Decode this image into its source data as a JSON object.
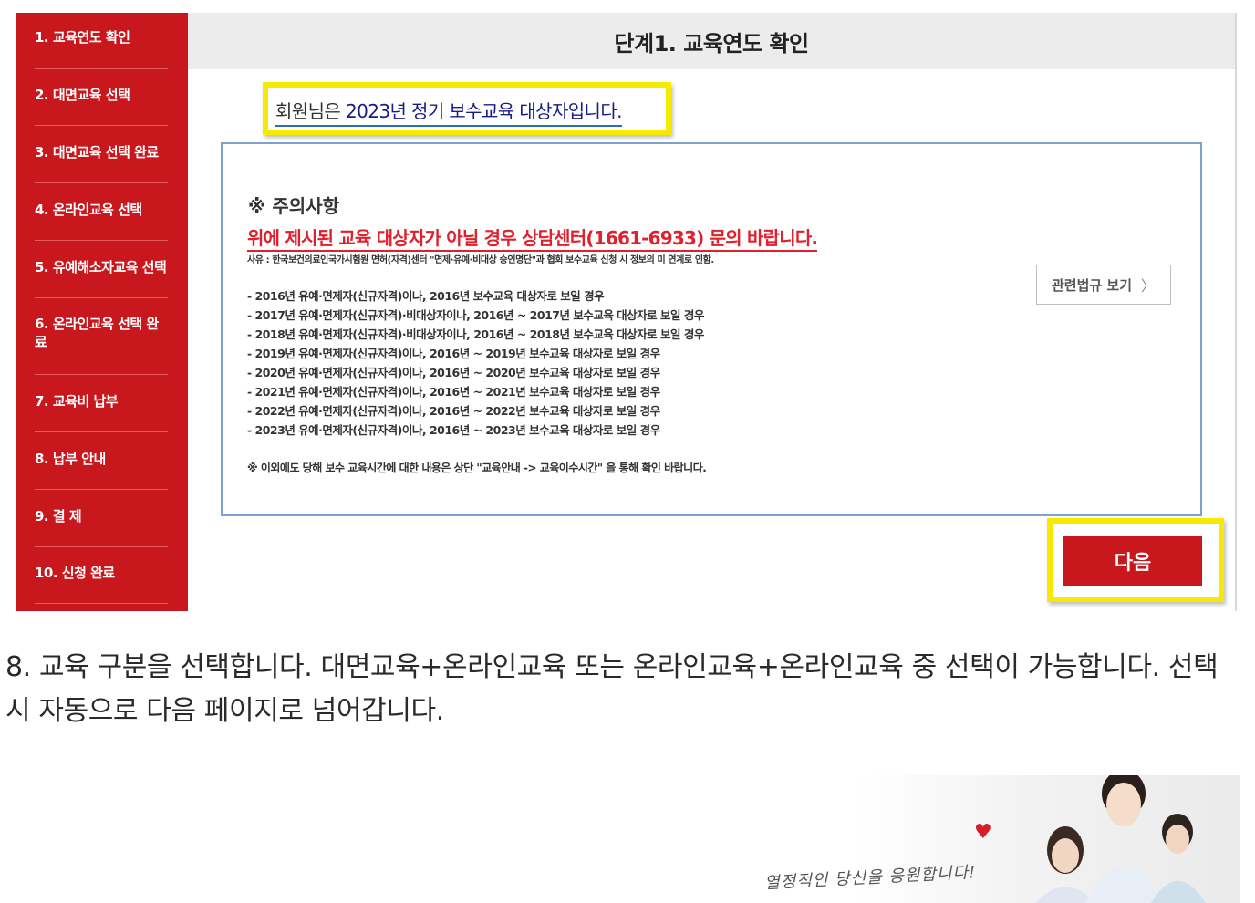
{
  "sidebar": {
    "items": [
      {
        "label": "1. 교육연도 확인"
      },
      {
        "label": "2. 대면교육 선택"
      },
      {
        "label": "3. 대면교육 선택 완료"
      },
      {
        "label": "4. 온라인교육 선택"
      },
      {
        "label": "5. 유예해소자교육 선택"
      },
      {
        "label": "6. 온라인교육 선택 완료"
      },
      {
        "label": "7. 교육비 납부"
      },
      {
        "label": "8. 납부 안내"
      },
      {
        "label": "9. 결 제"
      },
      {
        "label": "10. 신청 완료"
      }
    ]
  },
  "main": {
    "title": "단계1. 교육연도 확인",
    "target_prefix": "회원님은 ",
    "target_highlight": "2023년 정기 보수교육 대상자입니다.",
    "notice": {
      "heading": "※ 주의사항",
      "warning": "위에 제시된 교육 대상자가 아닐 경우 상담센터(1661-6933) 문의 바랍니다.",
      "reason": "사유 : 한국보건의료인국가시험원 면허(자격)센터 \"면제·유예·비대상 승인명단\"과 협회 보수교육 신청 시 정보의 미 연계로 인함.",
      "items": [
        "- 2016년 유예·면제자(신규자격)이나, 2016년 보수교육 대상자로 보일 경우",
        "- 2017년 유예·면제자(신규자격)·비대상자이나, 2016년 ~ 2017년 보수교육 대상자로 보일 경우",
        "- 2018년 유예·면제자(신규자격)·비대상자이나, 2016년 ~ 2018년 보수교육 대상자로 보일 경우",
        "- 2019년 유예·면제자(신규자격)이나, 2016년 ~ 2019년 보수교육 대상자로 보일 경우",
        "- 2020년 유예·면제자(신규자격)이나, 2016년 ~ 2020년 보수교육 대상자로 보일 경우",
        "- 2021년 유예·면제자(신규자격)이나, 2016년 ~ 2021년 보수교육 대상자로 보일 경우",
        "- 2022년 유예·면제자(신규자격)이나, 2016년 ~ 2022년 보수교육 대상자로 보일 경우",
        "- 2023년 유예·면제자(신규자격)이나, 2016년 ~ 2023년 보수교육 대상자로 보일 경우"
      ],
      "footnote": "※ 이외에도 당해 보수 교육시간에 대한 내용은 상단 \"교육안내 -> 교육이수시간\" 을 통해 확인 바랍니다.",
      "law_button": "관련법규 보기",
      "law_chevron": "〉"
    },
    "next_button": "다음"
  },
  "instruction": {
    "text": "8. 교육 구분을 선택합니다. 대면교육+온라인교육 또는 온라인교육+온라인교육 중 선택이 가능합니다. 선택 시 자동으로 다음 페이지로 넘어갑니다."
  },
  "banner": {
    "text": "열정적인 당신을 응원합니다!"
  },
  "colors": {
    "sidebar_red": "#c8171d",
    "highlight_yellow": "#f5ea00",
    "warning_red": "#e0202c"
  }
}
